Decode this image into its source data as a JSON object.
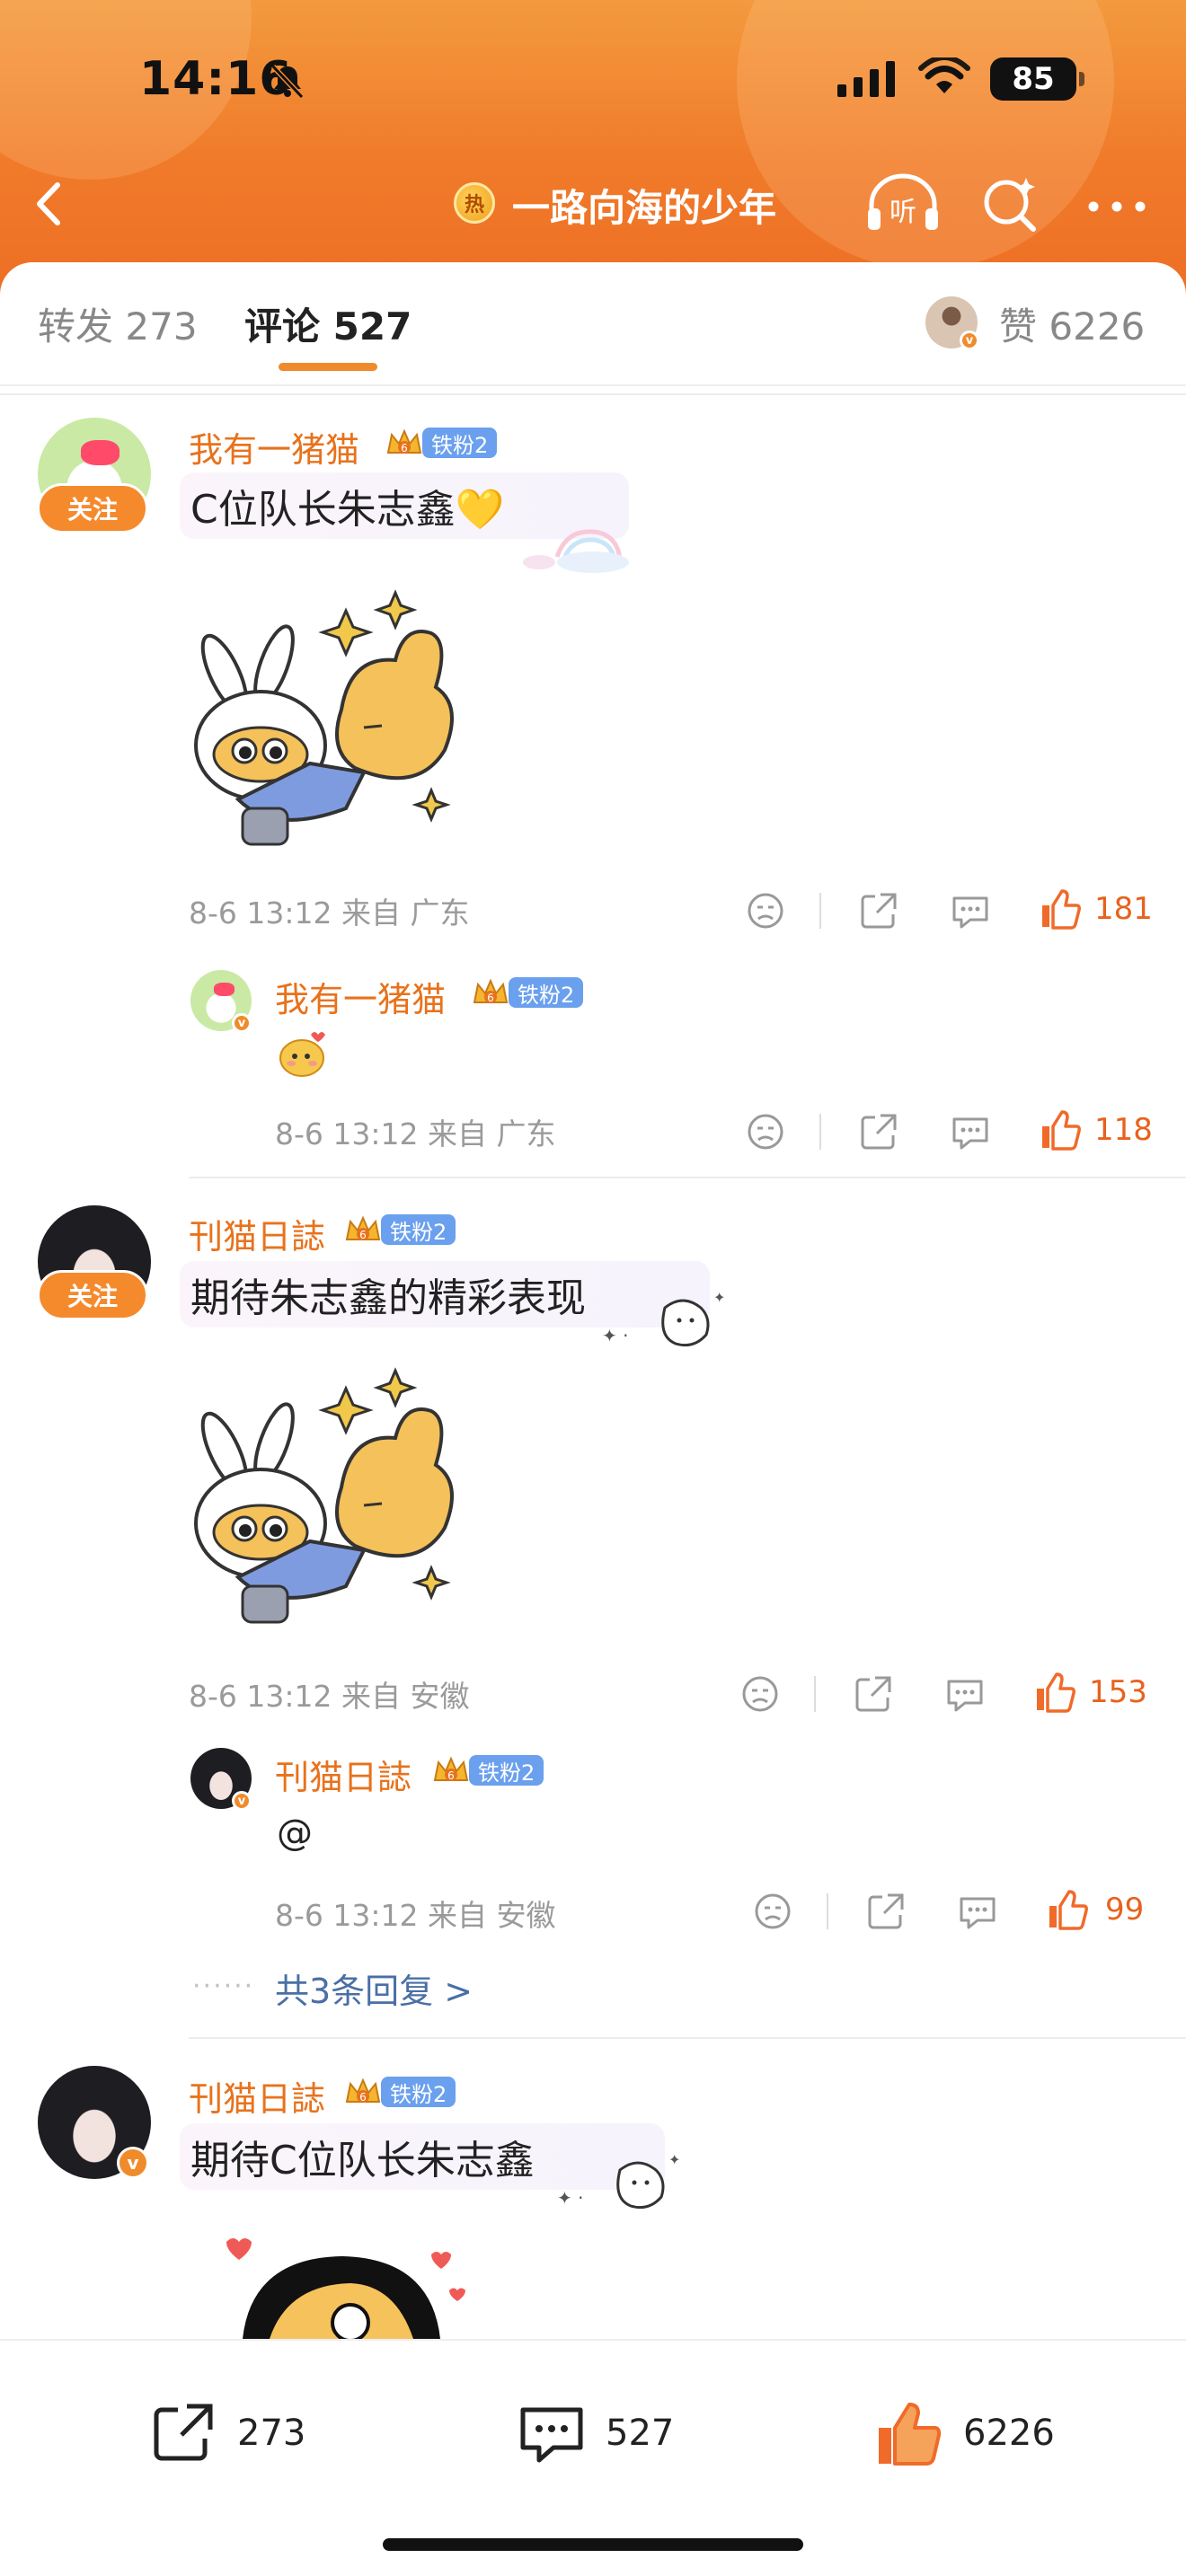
{
  "status_bar": {
    "time": "14:16",
    "battery": "85"
  },
  "nav": {
    "hot_badge": "热",
    "title": "一路向海的少年",
    "listen_label": "听"
  },
  "tabs": {
    "repost_label": "转发",
    "repost_count": "273",
    "comment_label": "评论",
    "comment_count": "527",
    "like_label": "赞",
    "like_count": "6226"
  },
  "comments": [
    {
      "user": "我有一猪猫",
      "fan_badge": "铁粉2",
      "follow": "关注",
      "text": "C位队长朱志鑫💛",
      "time": "8-6 13:12",
      "location": "来自 广东",
      "likes": "181",
      "reply": {
        "user": "我有一猪猫",
        "fan_badge": "铁粉2",
        "time": "8-6 13:12",
        "location": "来自 广东",
        "likes": "118"
      }
    },
    {
      "user": "刊猫日誌",
      "fan_badge": "铁粉2",
      "follow": "关注",
      "text": "期待朱志鑫的精彩表现",
      "time": "8-6 13:12",
      "location": "来自 安徽",
      "likes": "153",
      "reply": {
        "user": "刊猫日誌",
        "fan_badge": "铁粉2",
        "text": "@",
        "time": "8-6 13:12",
        "location": "来自 安徽",
        "likes": "99"
      },
      "more_replies": "共3条回复 >"
    },
    {
      "user": "刊猫日誌",
      "fan_badge": "铁粉2",
      "text": "期待C位队长朱志鑫"
    }
  ],
  "bottom_bar": {
    "repost_count": "273",
    "comment_count": "527",
    "like_count": "6226"
  },
  "colors": {
    "accent": "#f08b2c",
    "username": "#e8721c",
    "header_top": "#f39a3e",
    "header_bottom": "#ee6f24",
    "fan_badge": "#6aa0ee"
  }
}
